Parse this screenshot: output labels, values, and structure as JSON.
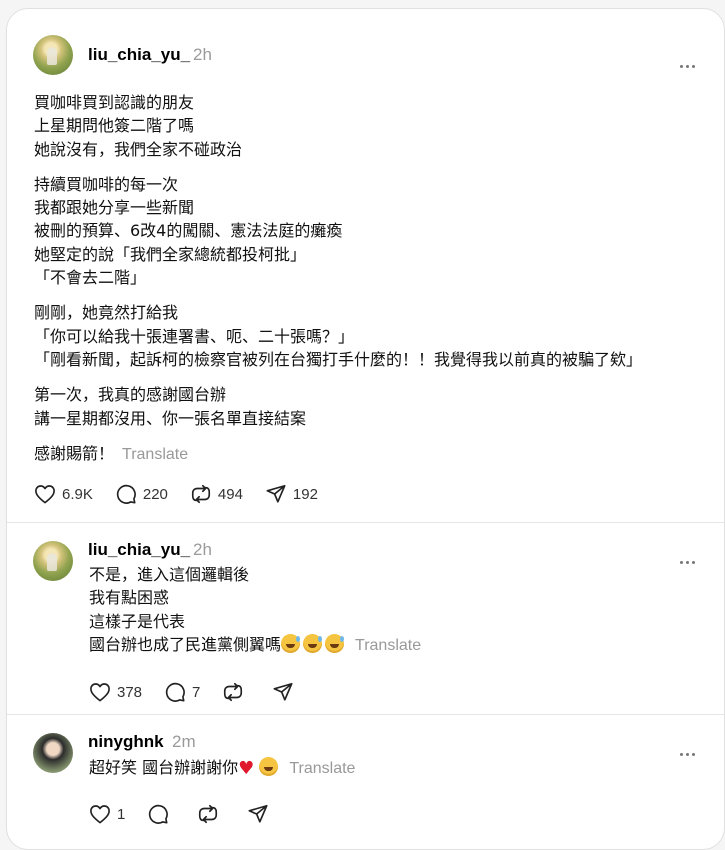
{
  "posts": [
    {
      "username": "liu_chia_yu_",
      "time": "2h",
      "paragraphs": [
        [
          "買咖啡買到認識的朋友",
          "上星期問他簽二階了嗎",
          "她說沒有，我們全家不碰政治"
        ],
        [
          "持續買咖啡的每一次",
          "我都跟她分享一些新聞",
          "被刪的預算、6改4的闖關、憲法法庭的癱瘓",
          "她堅定的說「我們全家總統都投柯批」",
          "「不會去二階」"
        ],
        [
          "剛剛，她竟然打給我",
          "「你可以給我十張連署書、呃、二十張嗎？」",
          "「剛看新聞，起訴柯的檢察官被列在台獨打手什麼的！！我覺得我以前真的被騙了欸」"
        ],
        [
          "第一次，我真的感謝國台辦",
          "講一星期都沒用、你一張名單直接結案"
        ]
      ],
      "last_line": "感謝賜箭！",
      "translate": "Translate",
      "likes": "6.9K",
      "replies": "220",
      "reposts": "494",
      "shares": "192"
    },
    {
      "username": "liu_chia_yu_",
      "time": "2h",
      "lines": [
        "不是，進入這個邏輯後",
        "我有點困惑",
        "這樣子是代表"
      ],
      "last_line": "國台辦也成了民進黨側翼嗎",
      "translate": "Translate",
      "likes": "378",
      "replies": "7"
    },
    {
      "username": "ninyghnk",
      "time": "2m",
      "last_line": "超好笑 國台辦謝謝你",
      "translate": "Translate",
      "likes": "1"
    }
  ],
  "icons": [
    "heart-icon",
    "comment-icon",
    "repost-icon",
    "share-icon",
    "more-icon"
  ],
  "colors": {
    "muted": "#9a9a9a",
    "heart": "#e0182d"
  }
}
